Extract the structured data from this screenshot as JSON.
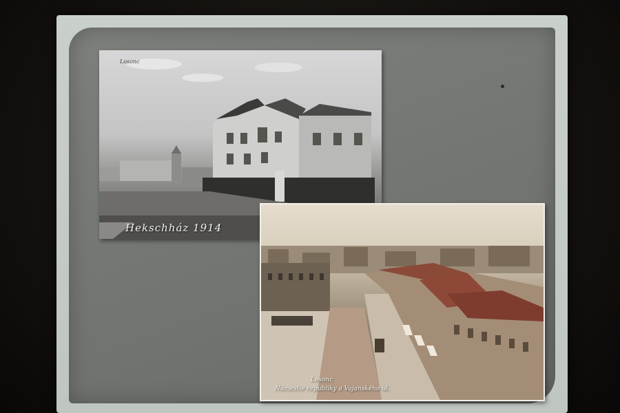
{
  "photos": [
    {
      "caption": "Hekschház 1914",
      "corner_label": "Losonc"
    },
    {
      "caption_line1": "Losonc",
      "caption_line2": "Námestie republiky a Vajanského ul."
    }
  ]
}
